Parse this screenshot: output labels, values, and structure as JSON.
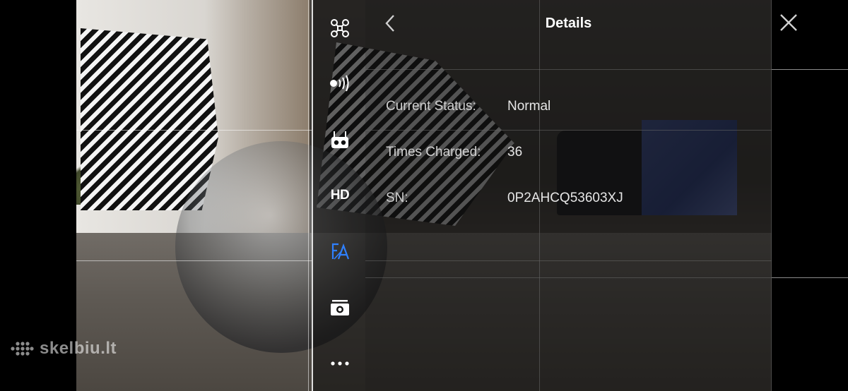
{
  "watermark": {
    "text": "skelbiu.lt"
  },
  "toolbar": {
    "items": [
      {
        "name": "aircraft-icon"
      },
      {
        "name": "signal-icon"
      },
      {
        "name": "remote-controller-icon"
      },
      {
        "name": "hd-icon",
        "label": "HD"
      },
      {
        "name": "battery-fa-icon",
        "active": true
      },
      {
        "name": "camera-icon"
      },
      {
        "name": "more-icon"
      }
    ],
    "active_color": "#2f80ff"
  },
  "details": {
    "title": "Details",
    "back_icon": "chevron-left-icon",
    "close_icon": "close-icon",
    "rows": [
      {
        "label": "Current Status:",
        "value": "Normal"
      },
      {
        "label": "Times Charged:",
        "value": "36"
      },
      {
        "label": "SN:",
        "value": "0P2AHCQ53603XJ"
      }
    ]
  }
}
